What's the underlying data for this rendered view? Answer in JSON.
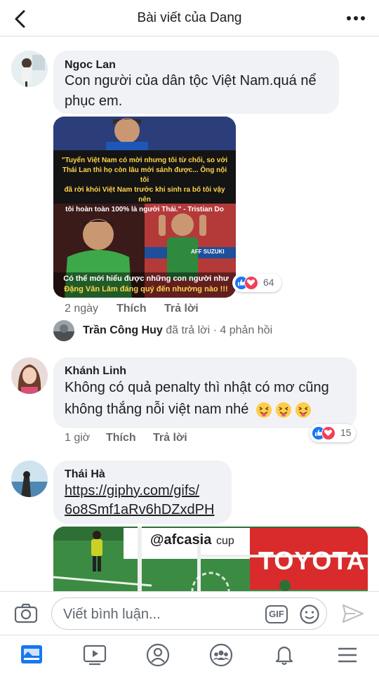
{
  "header": {
    "title": "Bài viết của Dang"
  },
  "comments": [
    {
      "author": "Ngoc Lan",
      "text_line1": "Con người của dân tộc Việt Nam.quá nể",
      "text_line2": "phục em.",
      "image": {
        "quote_line1": "\"Tuyển Việt Nam có mời nhưng tôi từ chối, so với",
        "quote_line2": "Thái Lan thì họ còn lâu mới sánh được... Ông nội tôi",
        "quote_line3": "đã rời khỏi Việt Nam trước khi sinh ra bố tôi vậy nên",
        "quote_line4": "tôi hoàn toàn 100% là người Thái.\" - Tristian Do",
        "caption_line1": "Có thể mới hiểu được những con người như",
        "caption_line2": "Đặng Văn Lâm đáng quý đến nhường nào !!!",
        "banner_text": "AFF SUZUKI"
      },
      "time": "2 ngày",
      "like": "Thích",
      "reply": "Trả lời",
      "reaction_count": "64",
      "reply_preview": {
        "name": "Trần Công Huy",
        "suffix": "đã trả lời · 4 phản hồi"
      }
    },
    {
      "author": "Khánh Linh",
      "text_line1": "Không có quả penalty thì nhật có mơ cũng",
      "text_line2": "không thắng nỗi việt nam nhé",
      "time": "1 giờ",
      "like": "Thích",
      "reply": "Trả lời",
      "reaction_count": "15"
    },
    {
      "author": "Thái Hà",
      "link_line1": "https://giphy.com/gifs/",
      "link_line2": "6o8Smf1aRv6hDZxdPH",
      "gif": {
        "board_text": "@afcasia",
        "board_text2": "cup",
        "sponsor": "TOYOTA"
      }
    }
  ],
  "composer": {
    "placeholder": "Viết bình luận...",
    "gif_label": "GIF"
  },
  "colors": {
    "like_blue": "#1877f2",
    "love_red": "#f33e58",
    "pitch_green": "#3c8b43"
  }
}
